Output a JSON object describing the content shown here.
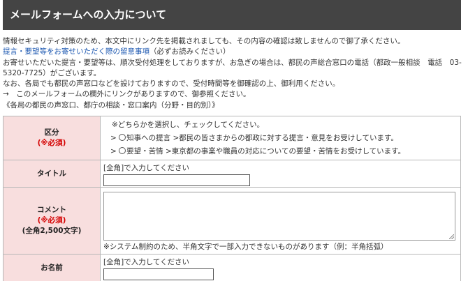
{
  "header": {
    "title": "メールフォームへの入力について"
  },
  "intro": {
    "line1": "情報セキュリティ対策のため、本文中にリンク先を掲載されましても、その内容の確認は致しませんので御了承ください。",
    "link1": "提言・要望等をお寄せいただく際の留意事項",
    "link1_suffix": "（必ずお読みください）",
    "line3": "お寄せいただいた提言・要望等は、順次受付処理をしておりますが、お急ぎの場合は、都民の声総合窓口の電話（都政一般相談　電話　03-5320-7725）がございます。",
    "line4": "なお、各局でも都民の声窓口などを設けておりますので、受付時間等を御確認の上、御利用ください。",
    "line5": "→　このメールフォームの欄外にリンクがありますので、御参照ください。",
    "line6": "《各局の都民の声窓口、都庁の相談・窓口案内（分野・目的別）》"
  },
  "form": {
    "kubun": {
      "label": "区分",
      "required": "(※必須)",
      "note": "※どちらかを選択し、チェックしてください。",
      "options": [
        {
          "prefix": ">",
          "label": "知事への提言 >都民の皆さまからの都政に対する提言・意見をお受けしています。"
        },
        {
          "prefix": ">",
          "label": "要望・苦情 >東京都の事業や職員の対応についての要望・苦情をお受けしています。"
        }
      ]
    },
    "title": {
      "label": "タイトル",
      "hint": "[全角]で入力してください",
      "value": ""
    },
    "comment": {
      "label": "コメント",
      "required": "(※必須)",
      "limit": "(全角2,500文字)",
      "value": "",
      "note": "※システム制約のため、半角文字で一部入力できないものがあります（例：半角括弧）"
    },
    "name": {
      "label": "お名前",
      "hint": "[全角]で入力してください",
      "value": ""
    }
  }
}
